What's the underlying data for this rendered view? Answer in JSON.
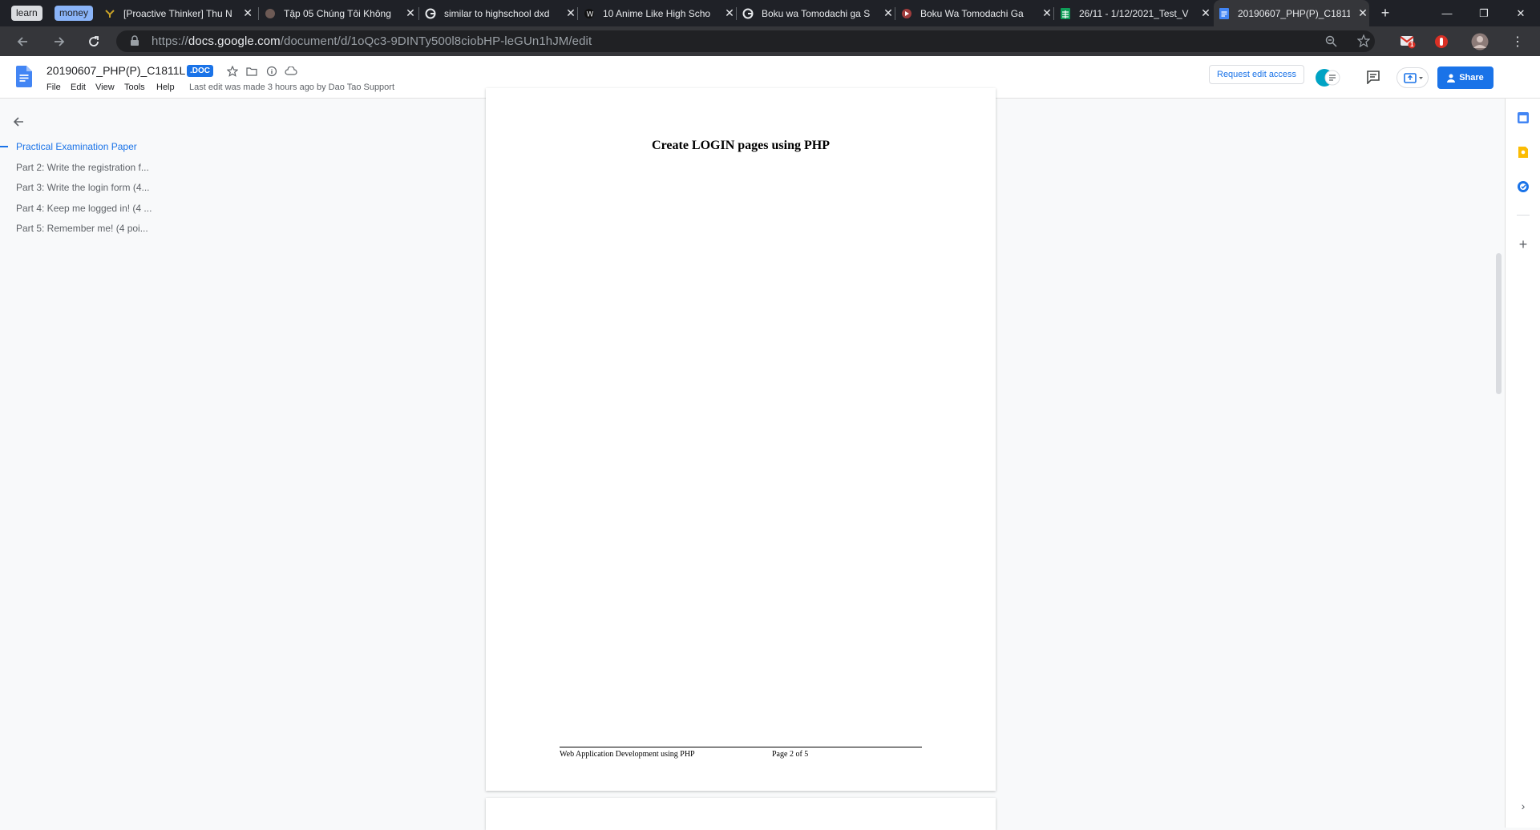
{
  "tab_groups": [
    {
      "label": "learn",
      "bg": "#dadce0",
      "fg": "#202124"
    },
    {
      "label": "money",
      "bg": "#8ab4f8",
      "fg": "#202124"
    }
  ],
  "tabs": [
    {
      "title": "[Proactive Thinker] Thu N",
      "icon": "yellow-logo-icon"
    },
    {
      "title": "Tập 05 Chúng Tôi Không",
      "icon": "anime-site-icon"
    },
    {
      "title": "similar to highschool dxd",
      "icon": "google-icon"
    },
    {
      "title": "10 Anime Like High Scho",
      "icon": "wordpress-icon"
    },
    {
      "title": "Boku wa Tomodachi ga S",
      "icon": "google-icon"
    },
    {
      "title": "Boku Wa Tomodachi Ga",
      "icon": "video-site-icon"
    },
    {
      "title": "26/11 - 1/12/2021_Test_V",
      "icon": "sheets-icon"
    },
    {
      "title": "20190607_PHP(P)_C1811",
      "icon": "docs-icon",
      "active": true
    }
  ],
  "omnibox": {
    "url_prefix": "https://",
    "url_host": "docs.google.com",
    "url_path": "/document/d/1oQc3-9DINTy500l8ciobHP-leGUn1hJM/edit"
  },
  "extensions": {
    "gmail_badge": "1"
  },
  "docs": {
    "title": "20190607_PHP(P)_C1811L",
    "format_badge": ".DOC",
    "menu": [
      "File",
      "Edit",
      "View",
      "Tools",
      "Help"
    ],
    "last_edit": "Last edit was made 3 hours ago by Dao Tao Support",
    "request_edit": "Request edit access",
    "share_label": "Share"
  },
  "outline": {
    "items": [
      {
        "label": "Practical Examination Paper",
        "active": true
      },
      {
        "label": "Part 2: Write the registration f...",
        "active": false
      },
      {
        "label": "Part 3: Write the login form (4...",
        "active": false
      },
      {
        "label": "Part 4: Keep me logged in! (4 ...",
        "active": false
      },
      {
        "label": "Part 5: Remember me! (4 poi...",
        "active": false
      }
    ]
  },
  "page": {
    "heading": "Create LOGIN pages using PHP",
    "footer_left": "Web Application Development using PHP",
    "footer_right": "Page 2 of 5"
  },
  "colors": {
    "accent": "#1a73e8",
    "tab_strip": "#1f2127",
    "toolbar": "#35363a"
  }
}
